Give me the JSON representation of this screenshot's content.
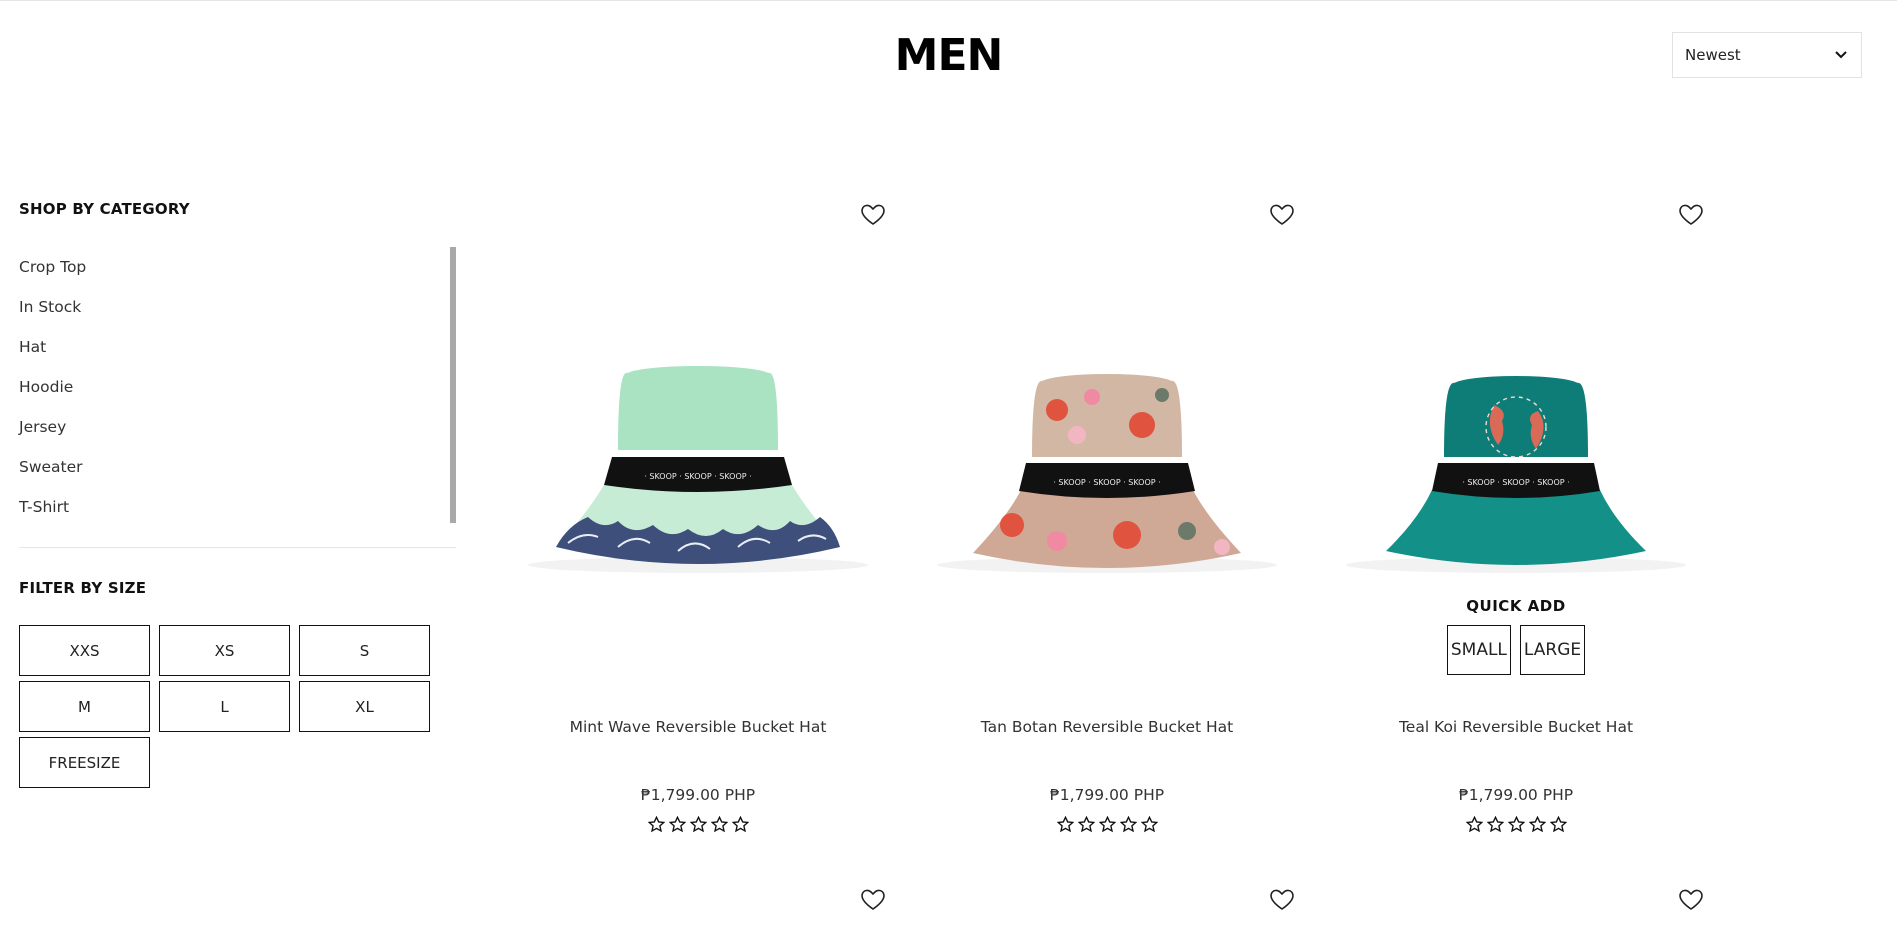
{
  "page": {
    "title": "MEN"
  },
  "sort": {
    "selected": "Newest"
  },
  "sidebar": {
    "category_title": "SHOP BY CATEGORY",
    "categories": [
      "Crop Top",
      "In Stock",
      "Hat",
      "Hoodie",
      "Jersey",
      "Sweater",
      "T-Shirt"
    ],
    "size_title": "FILTER BY SIZE",
    "sizes": [
      "XXS",
      "XS",
      "S",
      "M",
      "L",
      "XL",
      "FREESIZE"
    ]
  },
  "products": [
    {
      "name": "Mint Wave Reversible Bucket Hat",
      "price": "₱1,799.00 PHP",
      "rating": 0,
      "image": "mint-wave-bucket-hat",
      "colors": {
        "crown": "#a9e3c2",
        "brim": "#c6ecd6",
        "band": "#111111",
        "pattern": "#3d4f7a"
      }
    },
    {
      "name": "Tan Botan Reversible Bucket Hat",
      "price": "₱1,799.00 PHP",
      "rating": 0,
      "image": "tan-botan-bucket-hat",
      "colors": {
        "crown": "#d2b7a4",
        "brim": "#cfa996",
        "band": "#111111",
        "pattern": "#e0533f"
      }
    },
    {
      "name": "Teal Koi Reversible Bucket Hat",
      "price": "₱1,799.00 PHP",
      "rating": 0,
      "image": "teal-koi-bucket-hat",
      "colors": {
        "crown": "#0e7d77",
        "brim": "#139087",
        "band": "#111111",
        "pattern": "#d96a57"
      },
      "quick_add": {
        "label": "QUICK ADD",
        "options": [
          "SMALL",
          "LARGE"
        ]
      }
    }
  ],
  "next_row": {
    "count": 3
  }
}
